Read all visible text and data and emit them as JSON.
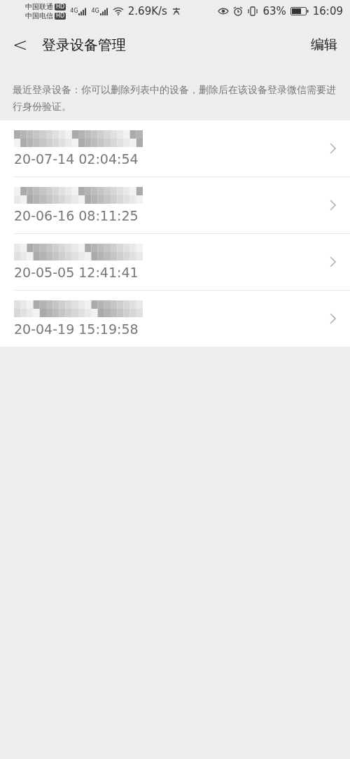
{
  "status_bar": {
    "carriers": [
      "中国联通",
      "中国电信"
    ],
    "carrier_badges": [
      "HD",
      "HD"
    ],
    "network_labels": [
      "4G",
      "4G"
    ],
    "speed": "2.69K/s",
    "battery": "63%",
    "time": "16:09"
  },
  "header": {
    "back": "<",
    "title": "登录设备管理",
    "action": "编辑"
  },
  "description": "最近登录设备：你可以删除列表中的设备，删除后在该设备登录微信需要进行身份验证。",
  "devices": [
    {
      "time": "20-07-14 02:04:54"
    },
    {
      "time": "20-06-16 08:11:25"
    },
    {
      "time": "20-05-05 12:41:41"
    },
    {
      "time": "20-04-19 15:19:58"
    }
  ]
}
